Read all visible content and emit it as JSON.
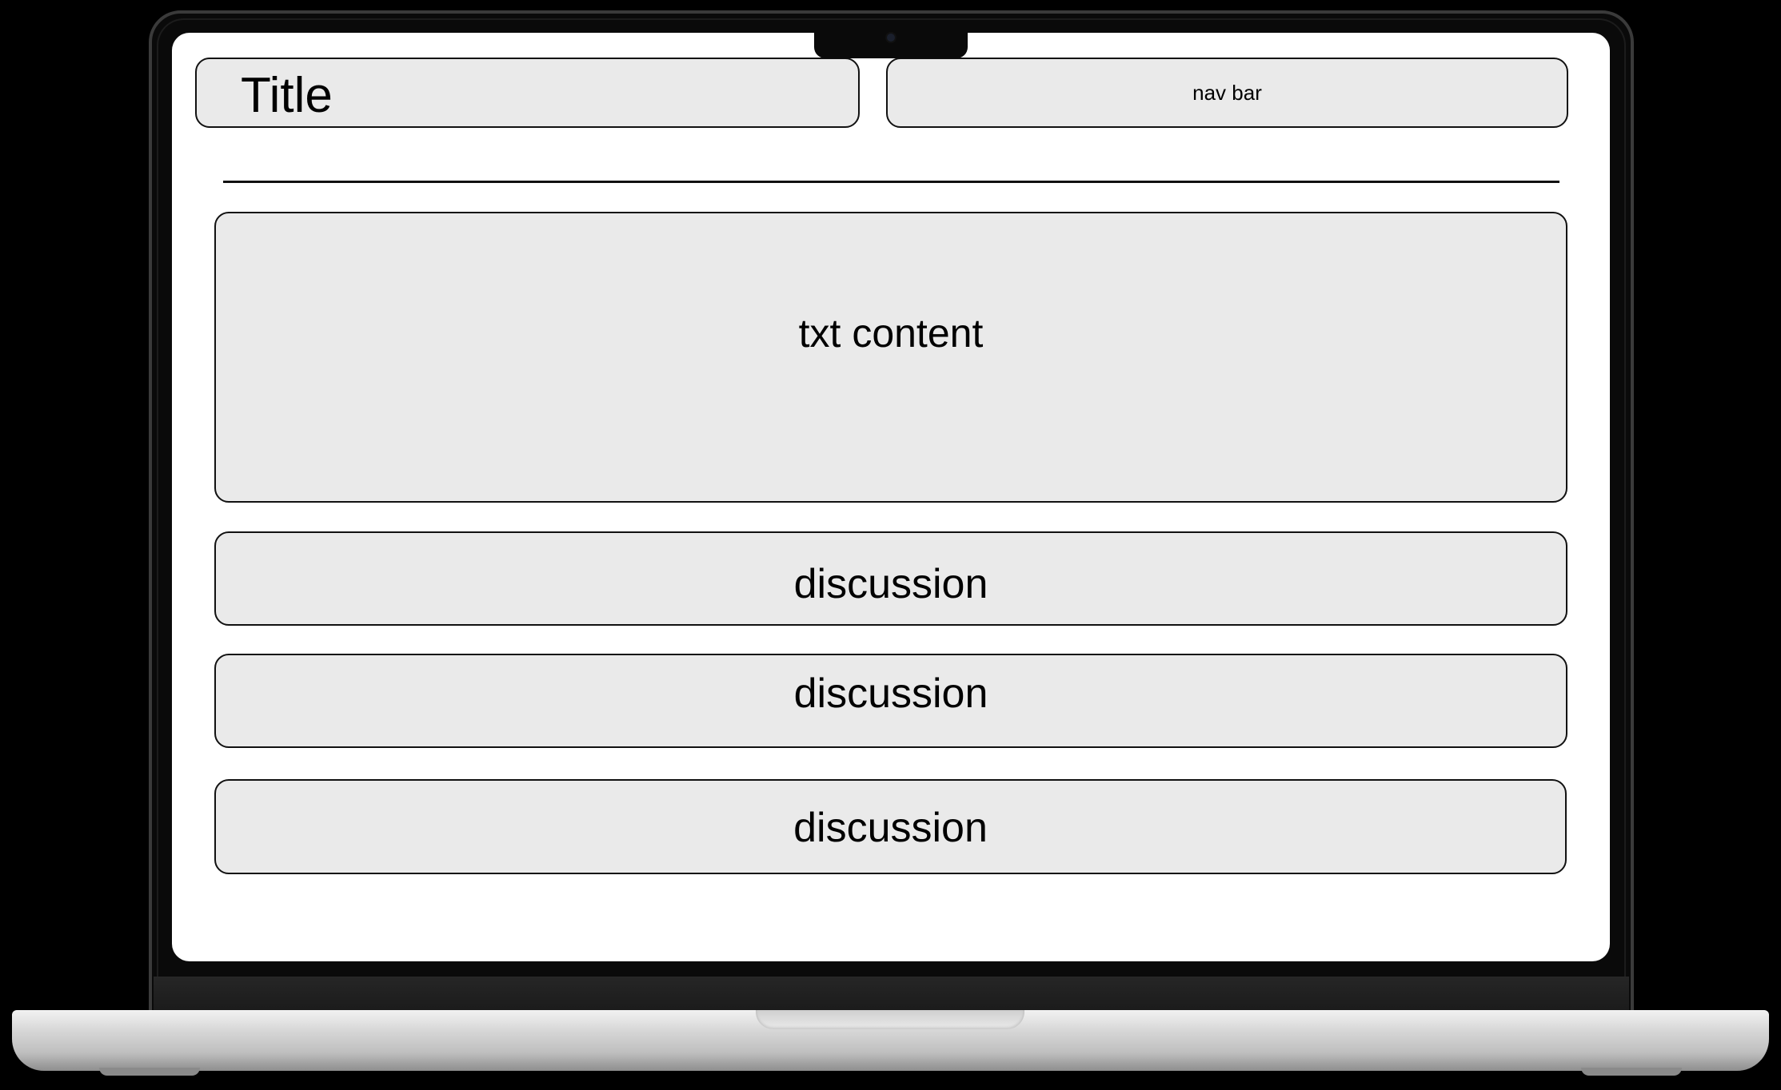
{
  "header": {
    "title": "Title",
    "nav_label": "nav bar"
  },
  "main": {
    "content_label": "txt content",
    "discussions": [
      {
        "label": "discussion"
      },
      {
        "label": "discussion"
      },
      {
        "label": "discussion"
      }
    ]
  },
  "colors": {
    "box_fill": "#eaeaea",
    "box_border": "#111111",
    "screen_bg": "#ffffff",
    "backdrop": "#000000"
  }
}
